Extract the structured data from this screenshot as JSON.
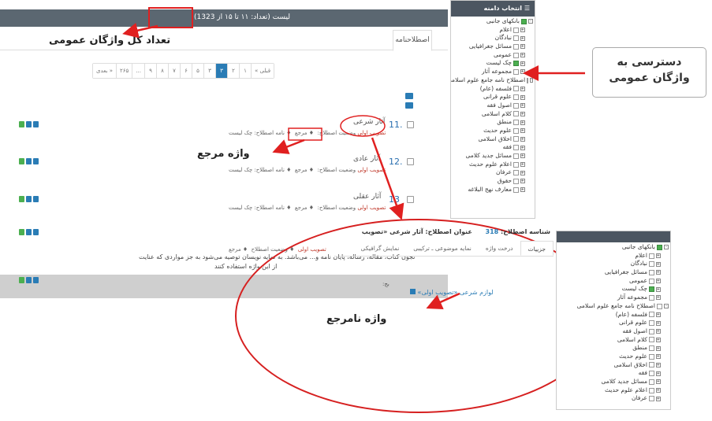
{
  "main": {
    "header_text": "لیست (تعداد: ۱۱ تا ۱۵ از 1323)",
    "count_highlight": "1323",
    "tab_label": "اصطلاحنامه",
    "callout_total": "تعداد کل واژگان عمومی",
    "pagination": [
      "بعدی »",
      "۲۶۵",
      "...",
      "۹",
      "۸",
      "۷",
      "۶",
      "۵",
      "۳",
      "۳",
      "۲",
      "۱",
      "« قبلی"
    ],
    "pagination_active_index": 9,
    "entries": [
      {
        "num": "11.",
        "title": "آثار شرعی",
        "meta_prefix": "نامه اصطلاح: چک لیست",
        "meta_ref": "مرجع",
        "meta_status_label": "وضعیت اصطلاح:",
        "meta_status": "تصویب اولی"
      },
      {
        "num": "12.",
        "title": "آثار عادی",
        "meta_prefix": "نامه اصطلاح: چک لیست",
        "meta_ref": "مرجع",
        "meta_status_label": "وضعیت اصطلاح:",
        "meta_status": "تصویب اولی"
      },
      {
        "num": "13",
        "title": "آثار عقلی",
        "meta_prefix": "نامه اصطلاح: چک لیست",
        "meta_ref": "مرجع",
        "meta_status_label": "وضعیت اصطلاح:",
        "meta_status": "تصویب اولی"
      }
    ],
    "entry4_meta_status": "تصویب اولی",
    "entry4_ref": "مرجع",
    "entry4_desc1": "نجون کتاب، مقاله، رساله، پایان نامه و... می‌باشد. به نمایه نویسان توصیه می‌شود به جز مواردی که عنایت",
    "entry4_desc2": "از این واژه استفاده کنند",
    "callout_ref": "واژه مرجع",
    "callout_nonref": "واژه نامرجع"
  },
  "tree": {
    "title": "انتخاب دامنه",
    "items": [
      {
        "label": "بانکهای جانبی",
        "level": 1,
        "checked": true,
        "expander": "-"
      },
      {
        "label": "اعلام",
        "level": 2,
        "checked": false,
        "expander": "+"
      },
      {
        "label": "نبادگان",
        "level": 2,
        "checked": false,
        "expander": "+"
      },
      {
        "label": "مسائل جغرافیایی",
        "level": 2,
        "checked": false,
        "expander": "+"
      },
      {
        "label": "عمومی",
        "level": 2,
        "checked": false,
        "expander": "+"
      },
      {
        "label": "چک لیست",
        "level": 2,
        "checked": true,
        "expander": "+"
      },
      {
        "label": "مجموعه آثار",
        "level": 2,
        "checked": false,
        "expander": "+"
      },
      {
        "label": "اصطلاح نامه جامع علوم اسلامی",
        "level": 1,
        "checked": false,
        "expander": "-"
      },
      {
        "label": "فلسفه (عام)",
        "level": 2,
        "checked": false,
        "expander": "+"
      },
      {
        "label": "علوم قرانی",
        "level": 2,
        "checked": false,
        "expander": "+"
      },
      {
        "label": "اصول فقه",
        "level": 2,
        "checked": false,
        "expander": "+"
      },
      {
        "label": "کلام اسلامی",
        "level": 2,
        "checked": false,
        "expander": "+"
      },
      {
        "label": "منطق",
        "level": 2,
        "checked": false,
        "expander": "+"
      },
      {
        "label": "علوم حدیث",
        "level": 2,
        "checked": false,
        "expander": "+"
      },
      {
        "label": "اخلاق اسلامی",
        "level": 2,
        "checked": false,
        "expander": "+"
      },
      {
        "label": "فقه",
        "level": 2,
        "checked": false,
        "expander": "+"
      },
      {
        "label": "مسائل جدید کلامی",
        "level": 2,
        "checked": false,
        "expander": "+"
      },
      {
        "label": "اعلام علوم حدیث",
        "level": 2,
        "checked": false,
        "expander": "+"
      },
      {
        "label": "عرفان",
        "level": 2,
        "checked": false,
        "expander": "+"
      },
      {
        "label": "حقوق",
        "level": 2,
        "checked": false,
        "expander": "+"
      },
      {
        "label": "معارف نهج البلاغه",
        "level": 2,
        "checked": false,
        "expander": "+"
      }
    ]
  },
  "callout_access": [
    "دسترسی به",
    "واژگان عمومی"
  ],
  "zoom": {
    "id_label": "شناسه اصطلاح:",
    "id_value": "318",
    "title_label": "عنوان اصطلاح: آثار شرعی «تصویب",
    "tabs": [
      "جزییات",
      "درخت واژه",
      "نمایه موضوعی ـ ترکیبی",
      "نمایش گرافیکی"
    ],
    "active_tab": 0,
    "use_label": "بج:",
    "link_text": "لوازم شرعی «تصویب اولی»"
  },
  "tree2": {
    "items": [
      {
        "label": "بانکهای جانبی",
        "level": 1,
        "checked": true,
        "expander": "-"
      },
      {
        "label": "اعلام",
        "level": 2,
        "checked": false,
        "expander": "+"
      },
      {
        "label": "نبادگان",
        "level": 2,
        "checked": false,
        "expander": "+"
      },
      {
        "label": "مسائل جغرافیایی",
        "level": 2,
        "checked": false,
        "expander": "+"
      },
      {
        "label": "عمومی",
        "level": 2,
        "checked": false,
        "expander": "+"
      },
      {
        "label": "چک لیست",
        "level": 2,
        "checked": true,
        "expander": "+"
      },
      {
        "label": "مجموعه آثار",
        "level": 2,
        "checked": false,
        "expander": "+"
      },
      {
        "label": "اصطلاح نامه جامع علوم اسلامی",
        "level": 1,
        "checked": false,
        "expander": "-"
      },
      {
        "label": "فلسفه (عام)",
        "level": 2,
        "checked": false,
        "expander": "+"
      },
      {
        "label": "علوم قرانی",
        "level": 2,
        "checked": false,
        "expander": "+"
      },
      {
        "label": "اصول فقه",
        "level": 2,
        "checked": false,
        "expander": "+"
      },
      {
        "label": "کلام اسلامی",
        "level": 2,
        "checked": false,
        "expander": "+"
      },
      {
        "label": "منطق",
        "level": 2,
        "checked": false,
        "expander": "+"
      },
      {
        "label": "علوم حدیث",
        "level": 2,
        "checked": false,
        "expander": "+"
      },
      {
        "label": "اخلاق اسلامی",
        "level": 2,
        "checked": false,
        "expander": "+"
      },
      {
        "label": "فقه",
        "level": 2,
        "checked": false,
        "expander": "+"
      },
      {
        "label": "مسائل جدید کلامی",
        "level": 2,
        "checked": false,
        "expander": "+"
      },
      {
        "label": "اعلام علوم حدیث",
        "level": 2,
        "checked": false,
        "expander": "+"
      },
      {
        "label": "عرفان",
        "level": 2,
        "checked": false,
        "expander": "+"
      }
    ]
  },
  "colors": {
    "header": "#5b6771",
    "accent": "#2a7cb5",
    "highlight": "#e02020",
    "status": "#c0392b"
  }
}
